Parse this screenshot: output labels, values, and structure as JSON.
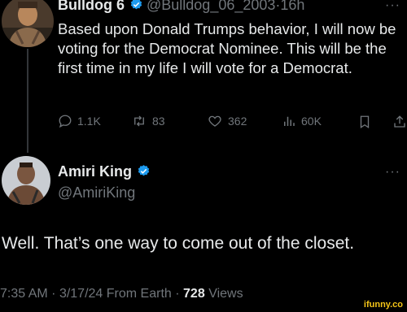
{
  "colors": {
    "background": "#000000",
    "text": "#e7e9ea",
    "muted": "#71767b",
    "verified": "#1d9bf0",
    "watermark": "#f5c518"
  },
  "tweet": {
    "display_name": "Bulldog 6",
    "handle": "@Bulldog_06_2003",
    "separator": "·",
    "time": "16h",
    "more": "···",
    "text": "Based upon Donald Trumps behavior, I will now be voting for the Democrat Nominee. This will be the first time in my life I will vote for a Democrat.",
    "actions": [
      {
        "icon": "reply-icon",
        "count": "1.1K"
      },
      {
        "icon": "retweet-icon",
        "count": "83"
      },
      {
        "icon": "like-icon",
        "count": "362"
      },
      {
        "icon": "views-icon",
        "count": "60K"
      },
      {
        "icon": "bookmark-icon",
        "count": ""
      },
      {
        "icon": "share-icon",
        "count": ""
      }
    ]
  },
  "reply": {
    "display_name": "Amiri King",
    "handle": "@AmiriKing",
    "more": "···",
    "text": "Well. That’s one way to come out of the closet.",
    "time": "7:35 AM",
    "date": "3/17/24",
    "source": "From Earth",
    "separator": "·",
    "views_count": "728",
    "views_label": "Views"
  },
  "watermark": "ifunny.co"
}
